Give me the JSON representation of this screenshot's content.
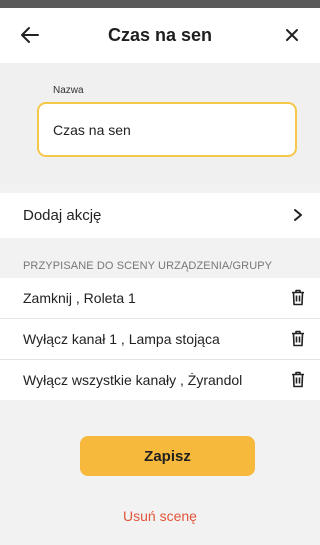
{
  "header": {
    "title": "Czas na sen",
    "back_icon": "arrow-left-icon",
    "close_icon": "close-icon"
  },
  "name_field": {
    "label": "Nazwa",
    "value": "Czas na sen"
  },
  "add_action": {
    "label": "Dodaj akcję",
    "icon": "chevron-right-icon"
  },
  "assigned_section": {
    "heading": "PRZYPISANE DO SCENY URZĄDZENIA/GRUPY",
    "items": [
      {
        "label": "Zamknij , Roleta 1",
        "icon": "trash-icon"
      },
      {
        "label": "Wyłącz kanał 1 , Lampa stojąca",
        "icon": "trash-icon"
      },
      {
        "label": "Wyłącz wszystkie kanały , Żyrandol",
        "icon": "trash-icon"
      }
    ]
  },
  "actions": {
    "save_label": "Zapisz",
    "delete_label": "Usuń scenę"
  },
  "colors": {
    "accent": "#f6b93b",
    "field_border": "#f5c84a",
    "danger": "#e2553a",
    "background": "#f2f2f2"
  }
}
